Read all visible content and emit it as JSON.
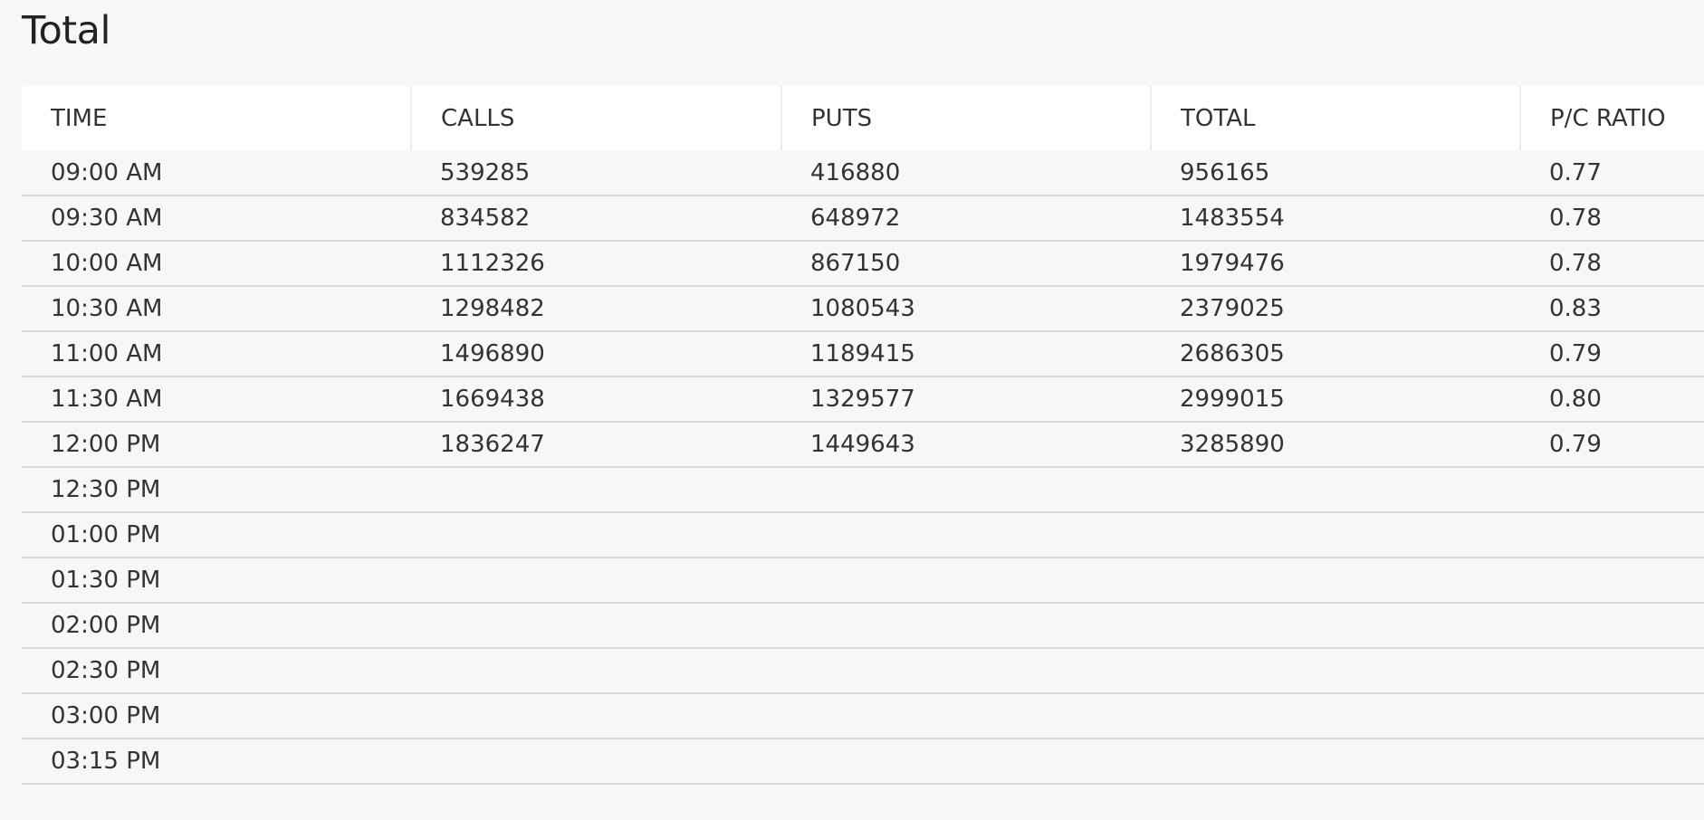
{
  "page": {
    "title": "Total"
  },
  "table": {
    "columns": [
      "TIME",
      "CALLS",
      "PUTS",
      "TOTAL",
      "P/C RATIO"
    ],
    "rows": [
      {
        "time": "09:00 AM",
        "calls": "539285",
        "puts": "416880",
        "total": "956165",
        "ratio": "0.77"
      },
      {
        "time": "09:30 AM",
        "calls": "834582",
        "puts": "648972",
        "total": "1483554",
        "ratio": "0.78"
      },
      {
        "time": "10:00 AM",
        "calls": "1112326",
        "puts": "867150",
        "total": "1979476",
        "ratio": "0.78"
      },
      {
        "time": "10:30 AM",
        "calls": "1298482",
        "puts": "1080543",
        "total": "2379025",
        "ratio": "0.83"
      },
      {
        "time": "11:00 AM",
        "calls": "1496890",
        "puts": "1189415",
        "total": "2686305",
        "ratio": "0.79"
      },
      {
        "time": "11:30 AM",
        "calls": "1669438",
        "puts": "1329577",
        "total": "2999015",
        "ratio": "0.80"
      },
      {
        "time": "12:00 PM",
        "calls": "1836247",
        "puts": "1449643",
        "total": "3285890",
        "ratio": "0.79"
      },
      {
        "time": "12:30 PM",
        "calls": "",
        "puts": "",
        "total": "",
        "ratio": ""
      },
      {
        "time": "01:00 PM",
        "calls": "",
        "puts": "",
        "total": "",
        "ratio": ""
      },
      {
        "time": "01:30 PM",
        "calls": "",
        "puts": "",
        "total": "",
        "ratio": ""
      },
      {
        "time": "02:00 PM",
        "calls": "",
        "puts": "",
        "total": "",
        "ratio": ""
      },
      {
        "time": "02:30 PM",
        "calls": "",
        "puts": "",
        "total": "",
        "ratio": ""
      },
      {
        "time": "03:00 PM",
        "calls": "",
        "puts": "",
        "total": "",
        "ratio": ""
      },
      {
        "time": "03:15 PM",
        "calls": "",
        "puts": "",
        "total": "",
        "ratio": ""
      }
    ]
  }
}
